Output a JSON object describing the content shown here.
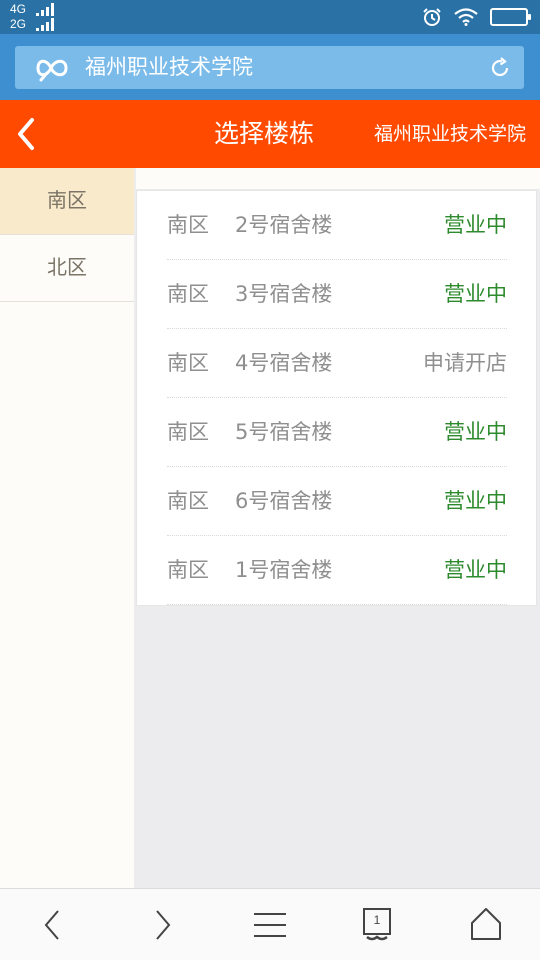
{
  "status_bar": {
    "network_1": "4G",
    "network_2": "2G",
    "icons": [
      "signal-icon",
      "alarm-icon",
      "wifi-icon",
      "battery-icon"
    ]
  },
  "browser": {
    "url_text": "福州职业技术学院",
    "icons": [
      "browser-logo-icon",
      "reload-icon"
    ]
  },
  "header": {
    "title": "选择楼栋",
    "school": "福州职业技术学院",
    "icons": [
      "back-chevron-icon"
    ]
  },
  "sidebar": {
    "items": [
      {
        "label": "南区",
        "active": true
      },
      {
        "label": "北区",
        "active": false
      }
    ]
  },
  "buildings": [
    {
      "area": "南区",
      "name": "2号宿舍楼",
      "status": "营业中",
      "open": true
    },
    {
      "area": "南区",
      "name": "3号宿舍楼",
      "status": "营业中",
      "open": true
    },
    {
      "area": "南区",
      "name": "4号宿舍楼",
      "status": "申请开店",
      "open": false
    },
    {
      "area": "南区",
      "name": "5号宿舍楼",
      "status": "营业中",
      "open": true
    },
    {
      "area": "南区",
      "name": "6号宿舍楼",
      "status": "营业中",
      "open": true
    },
    {
      "area": "南区",
      "name": "1号宿舍楼",
      "status": "营业中",
      "open": true
    }
  ],
  "colors": {
    "open_status": "#2d8a2d",
    "apply_status": "#8f8f8f",
    "header_bg": "#ff4a00",
    "browser_bg": "#3d8fd0"
  },
  "bottom_nav": {
    "tab_count": "1",
    "icons": [
      "back-icon",
      "forward-icon",
      "menu-icon",
      "tabs-icon",
      "home-icon"
    ]
  }
}
